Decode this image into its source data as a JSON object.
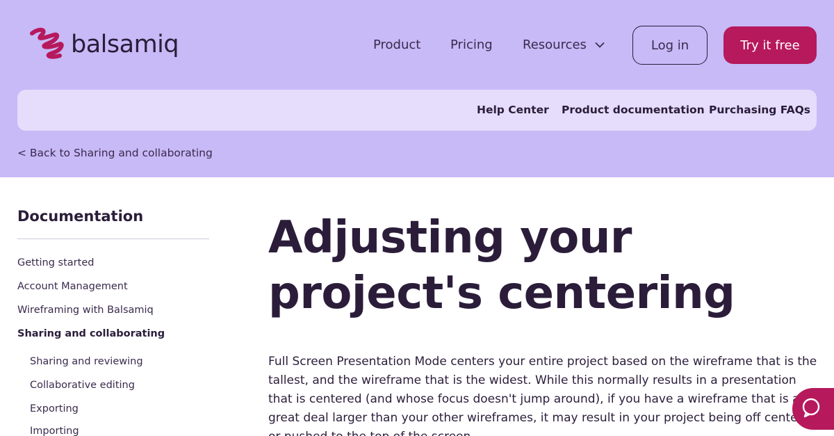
{
  "brand": {
    "name": "balsamiq",
    "logo_icon": "squiggle-logo-icon",
    "accent": "#b6195c",
    "hero_bg": "#c8b9f7"
  },
  "nav": {
    "product": "Product",
    "pricing": "Pricing",
    "resources": "Resources",
    "login": "Log in",
    "try_free": "Try it free"
  },
  "subnav": {
    "help_center": "Help Center",
    "product_docs": "Product documentation",
    "purchasing_faqs": "Purchasing FAQs"
  },
  "breadcrumb": {
    "back": "< Back to Sharing and collaborating"
  },
  "sidebar": {
    "title": "Documentation",
    "items": [
      {
        "label": "Getting started"
      },
      {
        "label": "Account Management"
      },
      {
        "label": "Wireframing with Balsamiq"
      },
      {
        "label": "Sharing and collaborating",
        "active": true
      }
    ],
    "subitems": [
      {
        "label": "Sharing and reviewing"
      },
      {
        "label": "Collaborative editing"
      },
      {
        "label": "Exporting"
      },
      {
        "label": "Importing"
      }
    ]
  },
  "main": {
    "title": "Adjusting your project's centering",
    "intro": "Full Screen Presentation Mode centers your entire project based on the wireframe that is the tallest, and the wireframe that is the widest. While this normally results in a presentation that is centered (and whose focus doesn't jump around), if you have a wireframe that is a great deal larger than your other wireframes, it may result in your project being off center, or pushed to the top of the screen."
  },
  "help_widget": {
    "icon": "chat-help-icon"
  }
}
